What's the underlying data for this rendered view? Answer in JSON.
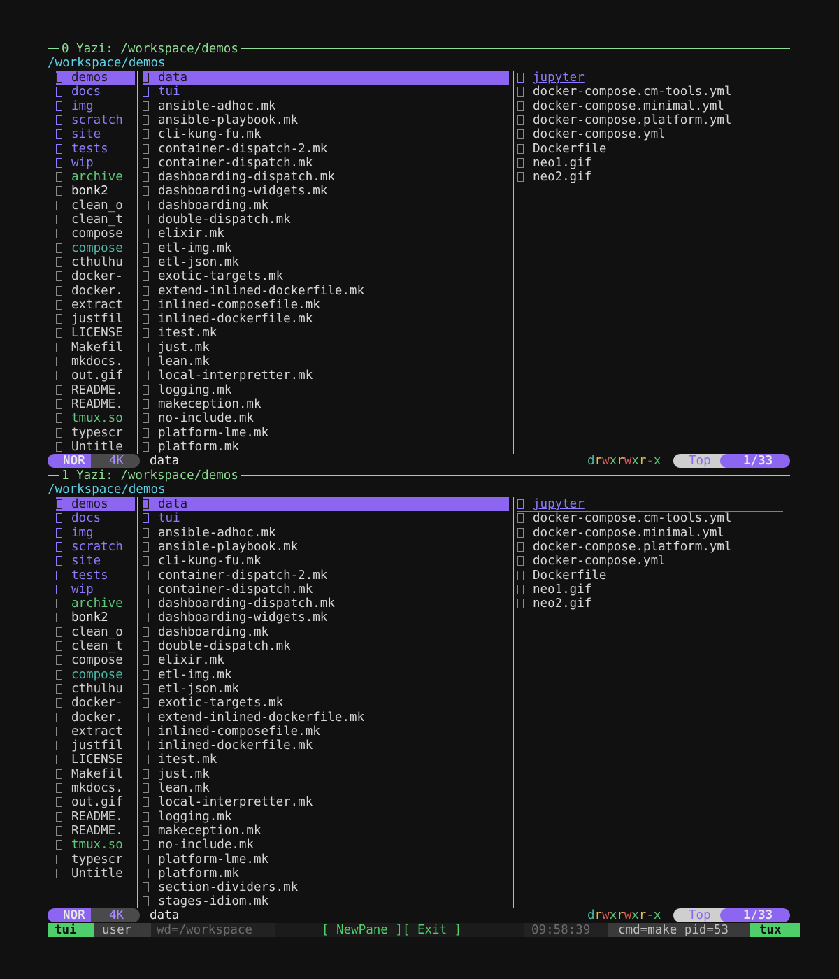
{
  "colors": {
    "accent": "#8c66f0",
    "dir": "#8c7cff",
    "green": "#5fc97a",
    "tmux_green": "#4fcf6c"
  },
  "panes": [
    {
      "title": "0 Yazi: /workspace/demos",
      "path": "/workspace/demos",
      "parent": [
        {
          "name": "demos",
          "kind": "dir",
          "selected": true
        },
        {
          "name": "docs",
          "kind": "dir"
        },
        {
          "name": "img",
          "kind": "dir"
        },
        {
          "name": "scratch",
          "kind": "dir"
        },
        {
          "name": "site",
          "kind": "dir"
        },
        {
          "name": "tests",
          "kind": "dir"
        },
        {
          "name": "wip",
          "kind": "dir"
        },
        {
          "name": "archive",
          "kind": "green"
        },
        {
          "name": "bonk2",
          "kind": "white"
        },
        {
          "name": "clean_o",
          "kind": "grey"
        },
        {
          "name": "clean_t",
          "kind": "grey"
        },
        {
          "name": "compose",
          "kind": "grey"
        },
        {
          "name": "compose",
          "kind": "teal"
        },
        {
          "name": "cthulhu",
          "kind": "grey"
        },
        {
          "name": "docker-",
          "kind": "grey"
        },
        {
          "name": "docker.",
          "kind": "grey"
        },
        {
          "name": "extract",
          "kind": "grey"
        },
        {
          "name": "justfil",
          "kind": "grey"
        },
        {
          "name": "LICENSE",
          "kind": "grey"
        },
        {
          "name": "Makefil",
          "kind": "grey"
        },
        {
          "name": "mkdocs.",
          "kind": "grey"
        },
        {
          "name": "out.gif",
          "kind": "grey"
        },
        {
          "name": "README.",
          "kind": "grey"
        },
        {
          "name": "README.",
          "kind": "grey"
        },
        {
          "name": "tmux.so",
          "kind": "green"
        },
        {
          "name": "typescr",
          "kind": "grey"
        },
        {
          "name": "Untitle",
          "kind": "grey"
        }
      ],
      "current": [
        {
          "name": "data",
          "kind": "dir",
          "selected": true
        },
        {
          "name": "tui",
          "kind": "dir"
        },
        {
          "name": "ansible-adhoc.mk"
        },
        {
          "name": "ansible-playbook.mk"
        },
        {
          "name": "cli-kung-fu.mk"
        },
        {
          "name": "container-dispatch-2.mk"
        },
        {
          "name": "container-dispatch.mk"
        },
        {
          "name": "dashboarding-dispatch.mk"
        },
        {
          "name": "dashboarding-widgets.mk"
        },
        {
          "name": "dashboarding.mk"
        },
        {
          "name": "double-dispatch.mk"
        },
        {
          "name": "elixir.mk"
        },
        {
          "name": "etl-img.mk"
        },
        {
          "name": "etl-json.mk"
        },
        {
          "name": "exotic-targets.mk"
        },
        {
          "name": "extend-inlined-dockerfile.mk"
        },
        {
          "name": "inlined-composefile.mk"
        },
        {
          "name": "inlined-dockerfile.mk"
        },
        {
          "name": "itest.mk"
        },
        {
          "name": "just.mk"
        },
        {
          "name": "lean.mk"
        },
        {
          "name": "local-interpretter.mk"
        },
        {
          "name": "logging.mk"
        },
        {
          "name": "makeception.mk"
        },
        {
          "name": "no-include.mk"
        },
        {
          "name": "platform-lme.mk"
        },
        {
          "name": "platform.mk"
        }
      ],
      "preview": [
        {
          "name": "jupyter",
          "kind": "dir",
          "underline": true
        },
        {
          "name": "docker-compose.cm-tools.yml"
        },
        {
          "name": "docker-compose.minimal.yml"
        },
        {
          "name": "docker-compose.platform.yml"
        },
        {
          "name": "docker-compose.yml"
        },
        {
          "name": "Dockerfile"
        },
        {
          "name": "neo1.gif"
        },
        {
          "name": "neo2.gif"
        }
      ],
      "status": {
        "mode": "NOR",
        "size": "4K",
        "name": "data",
        "perms": "drwxrwxr-x",
        "pos": "Top",
        "count": "1/33"
      }
    },
    {
      "title": "1 Yazi: /workspace/demos",
      "path": "/workspace/demos",
      "parent": [
        {
          "name": "demos",
          "kind": "dir",
          "selected": true
        },
        {
          "name": "docs",
          "kind": "dir"
        },
        {
          "name": "img",
          "kind": "dir"
        },
        {
          "name": "scratch",
          "kind": "dir"
        },
        {
          "name": "site",
          "kind": "dir"
        },
        {
          "name": "tests",
          "kind": "dir"
        },
        {
          "name": "wip",
          "kind": "dir"
        },
        {
          "name": "archive",
          "kind": "green"
        },
        {
          "name": "bonk2",
          "kind": "white"
        },
        {
          "name": "clean_o",
          "kind": "grey"
        },
        {
          "name": "clean_t",
          "kind": "grey"
        },
        {
          "name": "compose",
          "kind": "grey"
        },
        {
          "name": "compose",
          "kind": "teal"
        },
        {
          "name": "cthulhu",
          "kind": "grey"
        },
        {
          "name": "docker-",
          "kind": "grey"
        },
        {
          "name": "docker.",
          "kind": "grey"
        },
        {
          "name": "extract",
          "kind": "grey"
        },
        {
          "name": "justfil",
          "kind": "grey"
        },
        {
          "name": "LICENSE",
          "kind": "grey"
        },
        {
          "name": "Makefil",
          "kind": "grey"
        },
        {
          "name": "mkdocs.",
          "kind": "grey"
        },
        {
          "name": "out.gif",
          "kind": "grey"
        },
        {
          "name": "README.",
          "kind": "grey"
        },
        {
          "name": "README.",
          "kind": "grey"
        },
        {
          "name": "tmux.so",
          "kind": "green"
        },
        {
          "name": "typescr",
          "kind": "grey"
        },
        {
          "name": "Untitle",
          "kind": "grey"
        }
      ],
      "current": [
        {
          "name": "data",
          "kind": "dir",
          "selected": true
        },
        {
          "name": "tui",
          "kind": "dir"
        },
        {
          "name": "ansible-adhoc.mk"
        },
        {
          "name": "ansible-playbook.mk"
        },
        {
          "name": "cli-kung-fu.mk"
        },
        {
          "name": "container-dispatch-2.mk"
        },
        {
          "name": "container-dispatch.mk"
        },
        {
          "name": "dashboarding-dispatch.mk"
        },
        {
          "name": "dashboarding-widgets.mk"
        },
        {
          "name": "dashboarding.mk"
        },
        {
          "name": "double-dispatch.mk"
        },
        {
          "name": "elixir.mk"
        },
        {
          "name": "etl-img.mk"
        },
        {
          "name": "etl-json.mk"
        },
        {
          "name": "exotic-targets.mk"
        },
        {
          "name": "extend-inlined-dockerfile.mk"
        },
        {
          "name": "inlined-composefile.mk"
        },
        {
          "name": "inlined-dockerfile.mk"
        },
        {
          "name": "itest.mk"
        },
        {
          "name": "just.mk"
        },
        {
          "name": "lean.mk"
        },
        {
          "name": "local-interpretter.mk"
        },
        {
          "name": "logging.mk"
        },
        {
          "name": "makeception.mk"
        },
        {
          "name": "no-include.mk"
        },
        {
          "name": "platform-lme.mk"
        },
        {
          "name": "platform.mk"
        },
        {
          "name": "section-dividers.mk"
        },
        {
          "name": "stages-idiom.mk"
        }
      ],
      "preview": [
        {
          "name": "jupyter",
          "kind": "dir",
          "underline": true
        },
        {
          "name": "docker-compose.cm-tools.yml"
        },
        {
          "name": "docker-compose.minimal.yml"
        },
        {
          "name": "docker-compose.platform.yml"
        },
        {
          "name": "docker-compose.yml"
        },
        {
          "name": "Dockerfile"
        },
        {
          "name": "neo1.gif"
        },
        {
          "name": "neo2.gif"
        }
      ],
      "status": {
        "mode": "NOR",
        "size": "4K",
        "name": "data",
        "perms": "drwxrwxr-x",
        "pos": "Top",
        "count": "1/33"
      }
    }
  ],
  "tmux": {
    "session": "tui",
    "user": "user",
    "wd": "wd=/workspace",
    "center": "[ NewPane ][ Exit ]",
    "time": "09:58:39",
    "cmd": "cmd=make pid=53",
    "host": "tux"
  }
}
